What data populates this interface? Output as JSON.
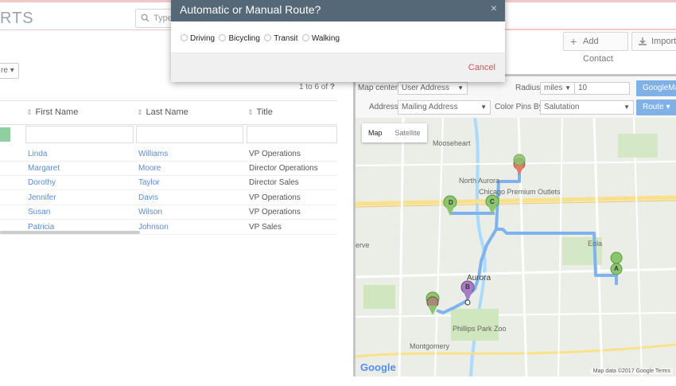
{
  "header": {
    "brand": "RTS",
    "search_placeholder": "Type"
  },
  "toolbar": {
    "add_contact": "Add Contact",
    "import": "Import",
    "more_label": "re"
  },
  "grid": {
    "pager": "1 to 6  of",
    "pager_help": "?",
    "columns": [
      "First Name",
      "Last Name",
      "Title"
    ],
    "rows": [
      {
        "first": "Linda",
        "last": "Williams",
        "title": "VP Operations"
      },
      {
        "first": "Margaret",
        "last": "Moore",
        "title": "Director Operations"
      },
      {
        "first": "Dorothy",
        "last": "Taylor",
        "title": "Director Sales"
      },
      {
        "first": "Jennifer",
        "last": "Davis",
        "title": "VP Operations"
      },
      {
        "first": "Susan",
        "last": "Wilson",
        "title": "VP Operations"
      },
      {
        "first": "Patricia",
        "last": "Johnson",
        "title": "VP Sales"
      }
    ]
  },
  "map_panel": {
    "map_center_label": "Map center:",
    "map_center_value": "User Address",
    "radius_label": "Radius:",
    "radius_unit": "miles",
    "radius_value": "10",
    "address_label": "Address:",
    "address_value": "Mailing Address",
    "color_pins_label": "Color Pins By:",
    "color_pins_value": "Salutation",
    "googlemap_button": "GoogleMa",
    "route_button": "Route",
    "map_types": [
      "Map",
      "Satellite"
    ],
    "google_logo": "Google",
    "footer": "Map data ©2017 Google   Terms",
    "places": [
      "Mooseheart",
      "North Aurora",
      "Chicago Premium Outlets",
      "Eola",
      "Aurora",
      "Phillips Park Zoo",
      "Montgomery",
      "erve"
    ],
    "pins": [
      "D",
      "C",
      "B",
      "A"
    ]
  },
  "modal": {
    "title": "Automatic or Manual Route?",
    "close": "×",
    "options": [
      "Driving",
      "Bicycling",
      "Transit",
      "Walking"
    ],
    "cancel": "Cancel"
  }
}
